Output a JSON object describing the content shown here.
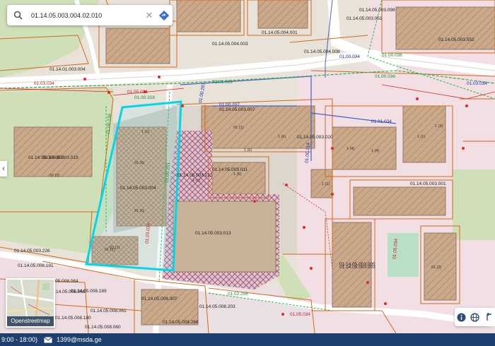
{
  "search": {
    "value": "01.14.05.003.004.02.010"
  },
  "minimap": {
    "label": "Openstreetmap"
  },
  "footer": {
    "hours": "9:00 - 18:00)",
    "email": "1399@msda.ge"
  },
  "colors": {
    "parcel": "#d2691e",
    "selected": "#00d8e8",
    "road": "#4a60c8",
    "green_line": "#2bb24a",
    "building": "#c9a98a"
  },
  "parcels": [
    {
      "id": "01.14.05.003.004"
    },
    {
      "id": "01.14.05.003.005"
    },
    {
      "id": "01.14.05.003.013"
    },
    {
      "id": "01.14.05.003.011"
    },
    {
      "id": "01.14.05.003.007"
    },
    {
      "id": "01.14.05.003.012"
    },
    {
      "id": "01.14.05.003.001"
    },
    {
      "id": "01.14.05.003.020"
    },
    {
      "id": "01.14.05.003.003"
    },
    {
      "id": "01.14.01.003.004"
    },
    {
      "id": "01.14.05.004.003"
    },
    {
      "id": "01.14.05.004.001"
    },
    {
      "id": "01.14.05.004.008"
    },
    {
      "id": "01.14.05.003.098"
    },
    {
      "id": "01.14.05.003.051"
    },
    {
      "id": "01.14.05.003.552"
    },
    {
      "id": "01.14.05.006.191"
    },
    {
      "id": "01.14.05.003.226"
    },
    {
      "id": "01.14.05.008.180"
    },
    {
      "id": "01.14.05.008.061"
    },
    {
      "id": "01.14.05.008.060"
    },
    {
      "id": "01.14.05.008.068"
    },
    {
      "id": "01.14.05.008.189"
    },
    {
      "id": "01.14.05.008.064"
    },
    {
      "id": "01.14.05.008.203"
    },
    {
      "id": "01.14.05.008.268"
    },
    {
      "id": "01.14.05.008.307"
    },
    {
      "id": "01.14.05.003.019"
    },
    {
      "id": "01.14.05.003.005"
    }
  ],
  "roads": [
    {
      "id": "01.01.034"
    },
    {
      "id": "01.00.207"
    },
    {
      "id": "01.00.318"
    },
    {
      "id": "01.05.034"
    },
    {
      "id": "01.00.036"
    },
    {
      "id": "01.03.034"
    },
    {
      "id": "01.01.019"
    },
    {
      "id": "01.03.034"
    },
    {
      "id": "01.00.036"
    },
    {
      "id": "01.00.287"
    },
    {
      "id": "01.00.214"
    },
    {
      "id": "01.03.034"
    },
    {
      "id": "01.00.136"
    },
    {
      "id": "01.00.201"
    },
    {
      "id": "01.05.034"
    },
    {
      "id": "01.02.256"
    },
    {
      "id": "01.00.034"
    },
    {
      "id": "01.05.034"
    }
  ],
  "building_labels": [
    "01 (6)",
    "01 (6)",
    "01 (1)",
    "02 (2)",
    "01 (1)",
    "1 (6)",
    "1 (6)",
    "1 (4)",
    "1 (4)",
    "1 (1)",
    "1 (1)",
    "1 (3)",
    "02 (1)",
    "01 (2)",
    "1 (1)",
    "1 (5)",
    "1 (1)"
  ]
}
